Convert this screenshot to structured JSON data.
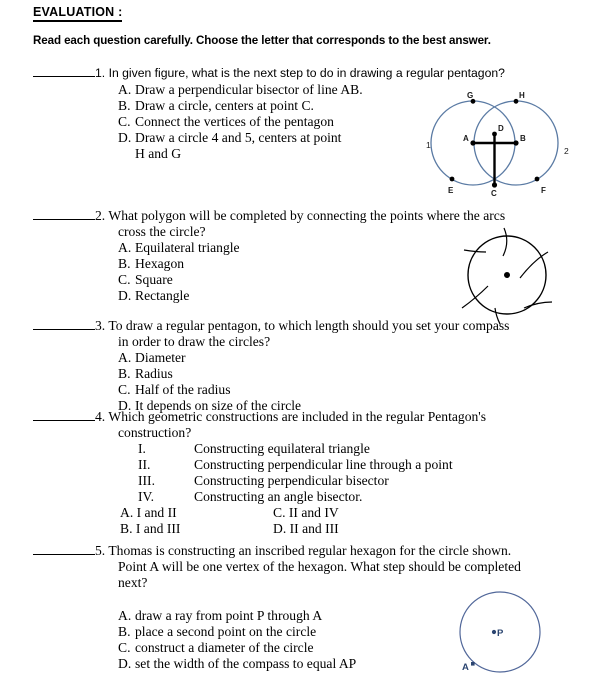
{
  "document": {
    "title": "EVALUATION :",
    "instruction": "Read each question carefully. Choose the letter that corresponds to the best answer."
  },
  "questions": [
    {
      "number": "1.",
      "blank": "__________",
      "stem_lines": [
        "In given figure, what is the next step to do in drawing a regular pentagon?"
      ],
      "choices": [
        {
          "label": "A.",
          "text": "Draw a perpendicular bisector of line AB."
        },
        {
          "label": "B.",
          "text": "Draw a circle, centers at point C."
        },
        {
          "label": "C.",
          "text": "Connect the vertices of the pentagon"
        },
        {
          "label": "D.",
          "text": "Draw a circle 4 and 5, centers at point",
          "continuation": "H and G"
        }
      ],
      "figure": {
        "name": "two-overlapping-circles-figure",
        "point_labels": [
          "G",
          "H",
          "D",
          "A",
          "B",
          "E",
          "C",
          "F"
        ],
        "circle_labels": [
          "1",
          "2"
        ],
        "stroke_color": "#5b7ba4"
      }
    },
    {
      "number": "2.",
      "blank": "__________",
      "stem_lines": [
        "What polygon will be completed by connecting the points where the arcs",
        "cross the circle?"
      ],
      "choices": [
        {
          "label": "A.",
          "text": "Equilateral triangle"
        },
        {
          "label": "B.",
          "text": "Hexagon"
        },
        {
          "label": "C.",
          "text": "Square"
        },
        {
          "label": "D.",
          "text": "Rectangle"
        }
      ],
      "figure": {
        "name": "circle-with-arcs-figure",
        "stroke_color": "#000000"
      }
    },
    {
      "number": "3.",
      "blank": "__________",
      "stem_lines": [
        "To draw a regular pentagon, to which length should you set your compass",
        "in order to draw the circles?"
      ],
      "choices": [
        {
          "label": "A.",
          "text": "Diameter"
        },
        {
          "label": "B.",
          "text": "Radius"
        },
        {
          "label": "C.",
          "text": "Half of the radius"
        },
        {
          "label": "D.",
          "text": "It depends on size of the circle"
        }
      ]
    },
    {
      "number": "4.",
      "blank": "__________",
      "stem_lines": [
        "Which geometric constructions are included in the regular Pentagon's",
        "construction?"
      ],
      "roman_items": [
        {
          "numeral": "I.",
          "text": "Constructing equilateral triangle"
        },
        {
          "numeral": "II.",
          "text": "Constructing perpendicular line through a point"
        },
        {
          "numeral": "III.",
          "text": "Constructing perpendicular bisector"
        },
        {
          "numeral": "IV.",
          "text": "Constructing an angle bisector."
        }
      ],
      "choice_rows": [
        {
          "left": "A.  I and II",
          "right": "C. II and IV"
        },
        {
          "left": "B.  I and III",
          "right": "D. II and III"
        }
      ]
    },
    {
      "number": "5.",
      "blank": "__________",
      "stem_lines": [
        "Thomas is constructing an inscribed regular hexagon for the circle shown.",
        "Point A will be one vertex of the hexagon. What step should be completed",
        "next?"
      ],
      "choices": [
        {
          "label": "A.",
          "text": "draw a ray from point P through A"
        },
        {
          "label": "B.",
          "text": "place a second point on the circle"
        },
        {
          "label": "C.",
          "text": "construct a diameter of the circle"
        },
        {
          "label": "D.",
          "text": "set the width of the compass to equal AP"
        }
      ],
      "figure": {
        "name": "circle-with-point-p-and-a-figure",
        "point_labels": [
          "P",
          "A"
        ],
        "stroke_color": "#52689a"
      }
    }
  ]
}
